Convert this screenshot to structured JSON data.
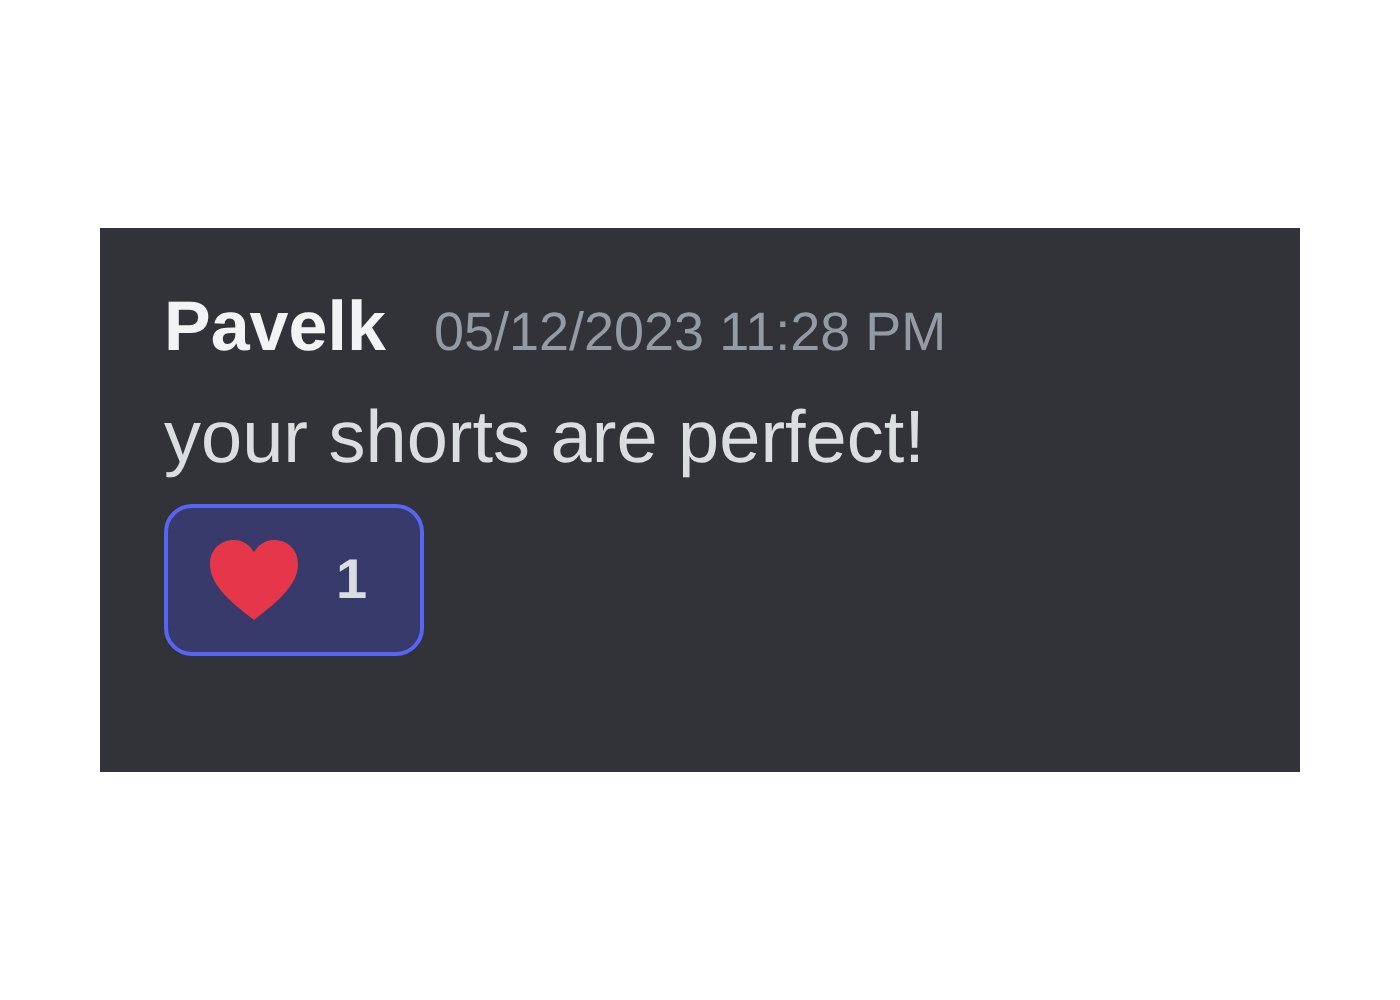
{
  "message": {
    "author": "Pavelk",
    "timestamp": "05/12/2023 11:28 PM",
    "text": "your shorts are perfect!",
    "reactions": [
      {
        "count": "1",
        "selected": true
      }
    ]
  }
}
